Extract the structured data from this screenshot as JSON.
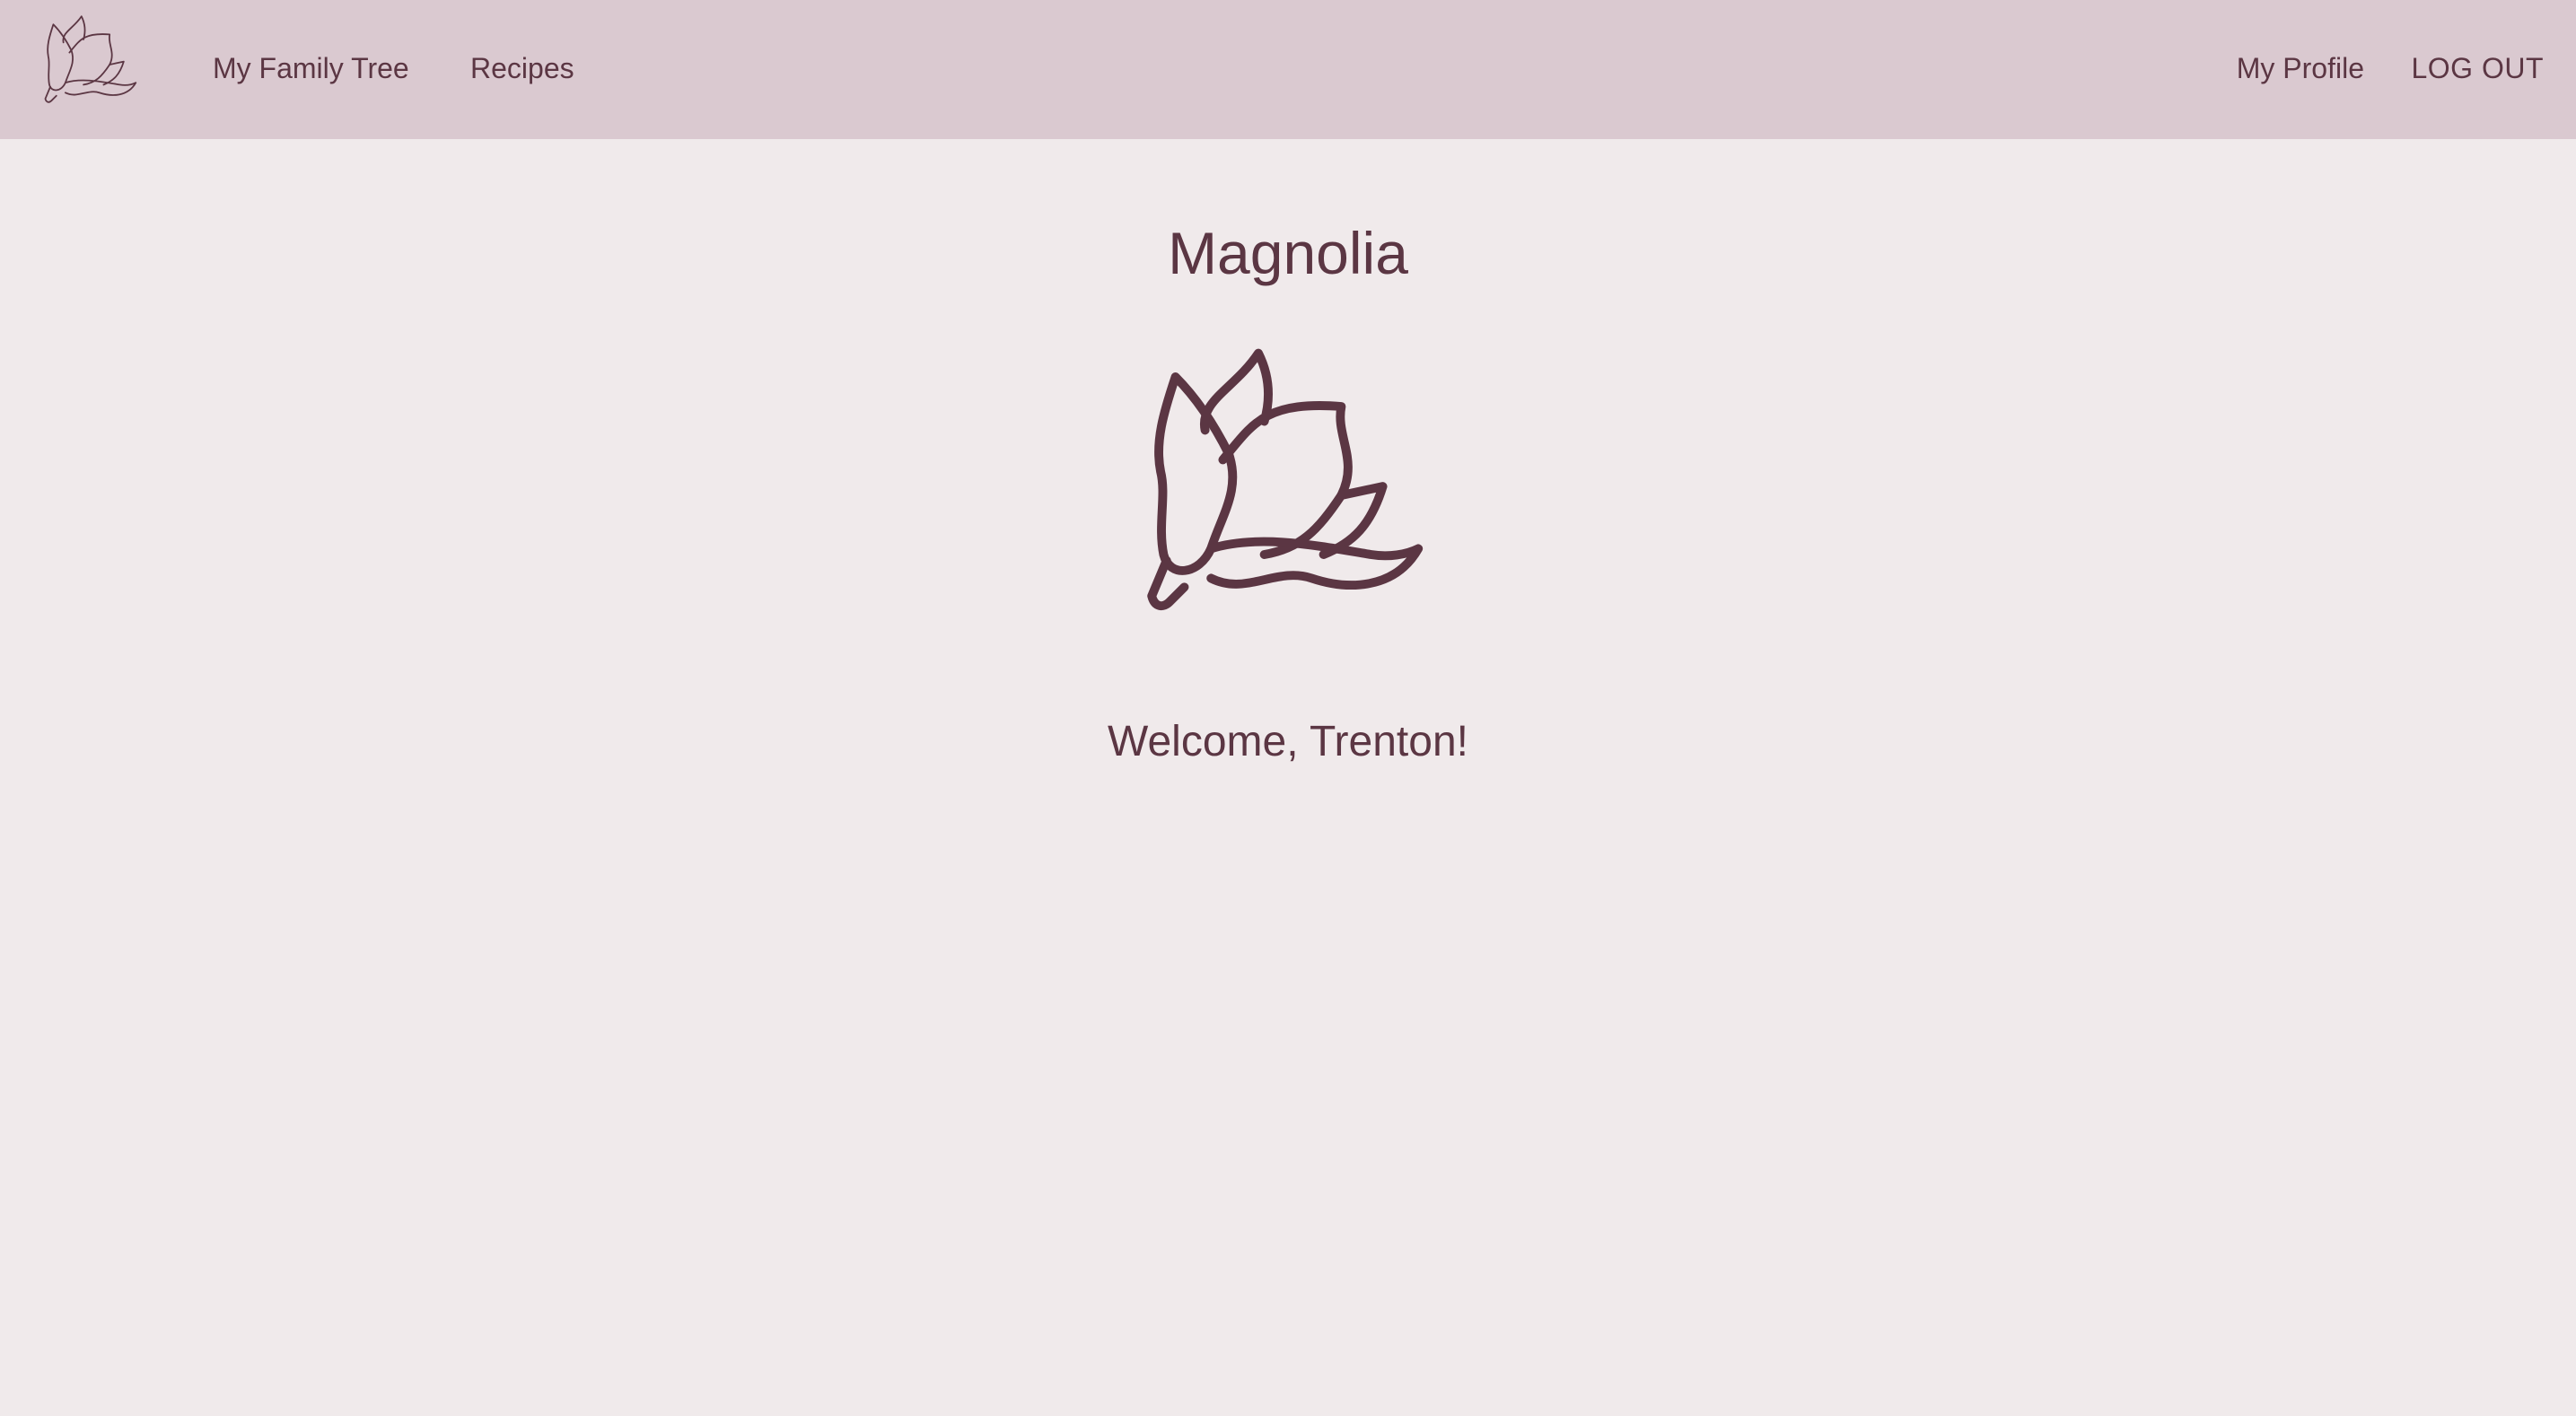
{
  "nav": {
    "logo_icon": "magnolia-flower-icon",
    "links": [
      {
        "label": "My Family Tree"
      },
      {
        "label": "Recipes"
      }
    ],
    "profile_label": "My Profile",
    "logout_label": "LOG OUT"
  },
  "main": {
    "title": "Magnolia",
    "hero_icon": "magnolia-flower-icon",
    "welcome_text": "Welcome, Trenton!"
  },
  "colors": {
    "navbar_bg": "#dac9d0",
    "page_bg": "#f0eaeb",
    "text": "#5b3643"
  }
}
